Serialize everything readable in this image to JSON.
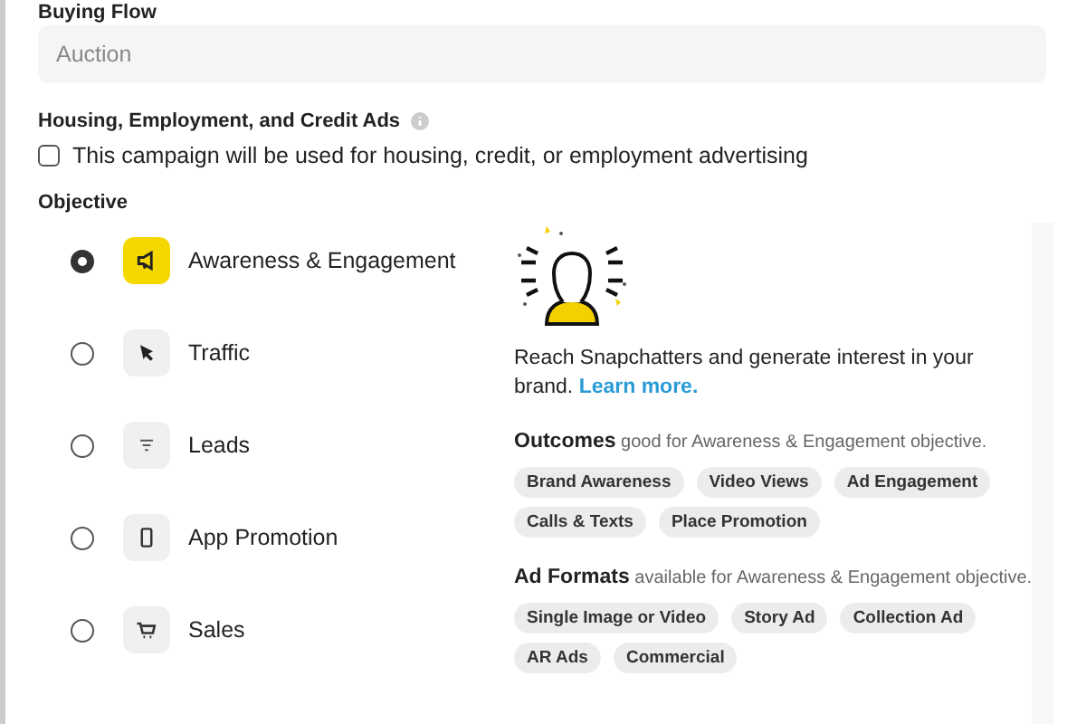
{
  "buying_flow": {
    "label": "Buying Flow",
    "value": "Auction"
  },
  "housing": {
    "label": "Housing, Employment, and Credit Ads",
    "checkbox_label": "This campaign will be used for housing, credit, or employment advertising",
    "checked": false
  },
  "objective": {
    "label": "Objective",
    "options": [
      {
        "label": "Awareness & Engagement",
        "selected": true
      },
      {
        "label": "Traffic",
        "selected": false
      },
      {
        "label": "Leads",
        "selected": false
      },
      {
        "label": "App Promotion",
        "selected": false
      },
      {
        "label": "Sales",
        "selected": false
      }
    ]
  },
  "details": {
    "description": "Reach Snapchatters and generate interest in your brand.",
    "link": "Learn more.",
    "outcomes_heading": "**Outcomes** good for Awareness & Engagement objective.",
    "outcomes": [
      "Brand Awareness",
      "Video Views",
      "Ad Engagement",
      "Calls & Texts",
      "Place Promotion"
    ],
    "formats_heading": "**Ad Formats** available for Awareness & Engagement objective.",
    "formats": [
      "Single Image or Video",
      "Story Ad",
      "Collection Ad",
      "AR Ads",
      "Commercial"
    ]
  }
}
